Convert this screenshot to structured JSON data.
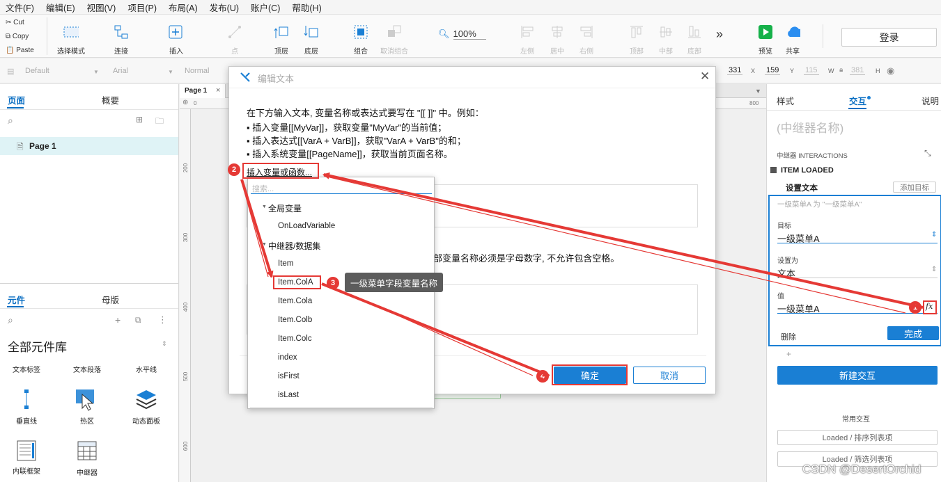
{
  "menu": [
    "文件(F)",
    "编辑(E)",
    "视图(V)",
    "项目(P)",
    "布局(A)",
    "发布(U)",
    "账户(C)",
    "帮助(H)"
  ],
  "clipboard": {
    "cut": "Cut",
    "copy": "Copy",
    "paste": "Paste"
  },
  "toolbar": {
    "select_mode": "选择模式",
    "connect": "连接",
    "insert": "插入",
    "point": "点",
    "top_layer": "顶层",
    "bottom_layer": "底层",
    "group": "组合",
    "ungroup": "取消组合",
    "zoom": "100%",
    "left": "左侧",
    "center": "居中",
    "right": "右侧",
    "top": "顶部",
    "middle": "中部",
    "bottom": "底部",
    "more": "»",
    "preview": "预览",
    "share": "共享",
    "login": "登录"
  },
  "formatbar": {
    "style": "Default",
    "font": "Arial",
    "weight": "Normal",
    "x": "331",
    "x_label": "X",
    "y": "159",
    "y_label": "Y",
    "w": "115",
    "w_label": "W",
    "h": "381",
    "h_label": "H"
  },
  "left_panel": {
    "tab_pages": "页面",
    "tab_outline": "概要",
    "page_item": "Page 1",
    "tab_widgets": "元件",
    "tab_masters": "母版",
    "library": "全部元件库",
    "widgets": [
      "文本标签",
      "文本段落",
      "水平线",
      "垂直线",
      "热区",
      "动态面板",
      "内联框架",
      "中继器"
    ]
  },
  "canvas": {
    "page_tab": "Page 1",
    "ruler_top": [
      "0",
      "800"
    ],
    "ruler_left": [
      "200",
      "300",
      "400",
      "500",
      "600"
    ]
  },
  "right_panel": {
    "tab_style": "样式",
    "tab_interact": "交互",
    "tab_notes": "说明",
    "name_placeholder": "(中继器名称)",
    "interactions_label": "中继器 INTERACTIONS",
    "event": "ITEM LOADED",
    "action": "设置文本",
    "add_target": "添加目标",
    "summary": "一级菜单A 为 \"一级菜单A\"",
    "target_label": "目标",
    "target_value": "一级菜单A",
    "set_as_label": "设置为",
    "set_as_value": "文本",
    "value_label": "值",
    "value_value": "一级菜单A",
    "delete": "删除",
    "done": "完成",
    "new_interaction": "新建交互",
    "common": "常用交互",
    "common_1": "Loaded / 排序列表项",
    "common_2": "Loaded / 筛选列表项"
  },
  "dialog": {
    "title": "编辑文本",
    "intro": "在下方输入文本, 变量名称或表达式要写在 \"[[ ]]\" 中。例如：",
    "line1": "▪ 插入变量[[MyVar]]，获取变量\"MyVar\"的当前值；",
    "line2": "▪ 插入表达式[[VarA + VarB]]，获取\"VarA + VarB\"的和；",
    "line3": "▪ 插入系统变量[[PageName]]，获取当前页面名称。",
    "insert_link": "插入变量或函数...",
    "local_note": "部变量名称必须是字母数字, 不允许包含空格。",
    "ok": "确定",
    "cancel": "取消"
  },
  "dropdown": {
    "search_placeholder": "搜索...",
    "group_global": "全局变量",
    "global_items": [
      "OnLoadVariable"
    ],
    "group_repeater": "中继器/数据集",
    "repeater_items": [
      "Item",
      "Item.ColA",
      "Item.Cola",
      "Item.Colb",
      "Item.Colc",
      "index",
      "isFirst",
      "isLast"
    ]
  },
  "annotations": {
    "badge1": "1",
    "badge2": "2",
    "badge3": "3",
    "badge4": "4",
    "tooltip": "一级菜单字段变量名称"
  },
  "watermark": "CSDN @DesertOrchid",
  "colors": {
    "accent": "#1a7fd4",
    "annotation": "#e53935"
  }
}
